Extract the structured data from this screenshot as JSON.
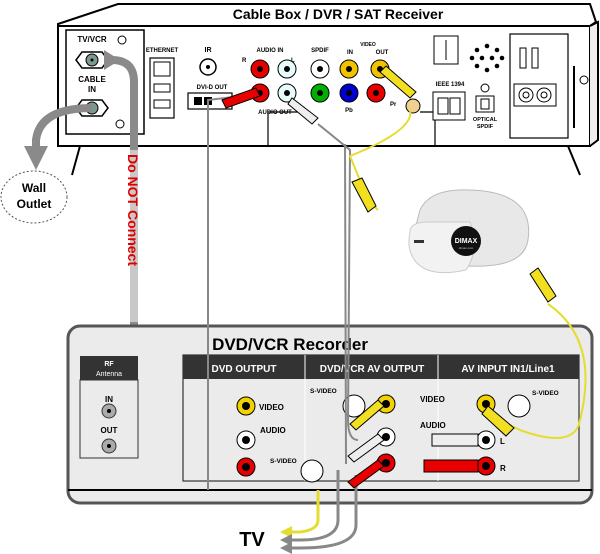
{
  "cable_box": {
    "title": "Cable Box / DVR / SAT Receiver",
    "labels": {
      "tv_vcr": "TV/VCR",
      "cable": "CABLE",
      "in": "IN",
      "ethernet": "ETHERNET",
      "ir": "IR",
      "dvi_out": "DVI-D OUT",
      "audio_in": "AUDIO IN",
      "r": "R",
      "l": "L",
      "audio_out": "AUDIO OUT",
      "spdif": "SPDIF",
      "video": "VIDEO",
      "video_in": "IN",
      "video_out": "OUT",
      "pb": "Pb",
      "pr": "Pr",
      "ieee": "IEEE 1394",
      "optical": "OPTICAL",
      "optical_spdif": "SPDIF"
    }
  },
  "wall_outlet": {
    "line1": "Wall",
    "line2": "Outlet"
  },
  "warning": {
    "text": "Do NOT Connect",
    "color": "#e00000"
  },
  "device": {
    "brand": "DIMAX",
    "sub": "dimax.com"
  },
  "recorder": {
    "title": "DVD/VCR Recorder",
    "rf": {
      "line1": "RF",
      "line2": "Antenna",
      "in": "IN",
      "out": "OUT"
    },
    "sections": [
      {
        "header": "DVD OUTPUT"
      },
      {
        "header": "DVD/VCR AV OUTPUT"
      },
      {
        "header": "AV INPUT IN1/Line1"
      }
    ],
    "labels": {
      "video": "VIDEO",
      "audio": "AUDIO",
      "svideo": "S-VIDEO",
      "l": "L",
      "r": "R"
    }
  },
  "tv": {
    "label": "TV"
  },
  "colors": {
    "yellow": "#f2d200",
    "red": "#e80000",
    "white": "#ffffff",
    "green": "#00b000",
    "blue": "#0000d0",
    "cable_gray": "#8a8a8a",
    "coax": "#7a9a90"
  }
}
